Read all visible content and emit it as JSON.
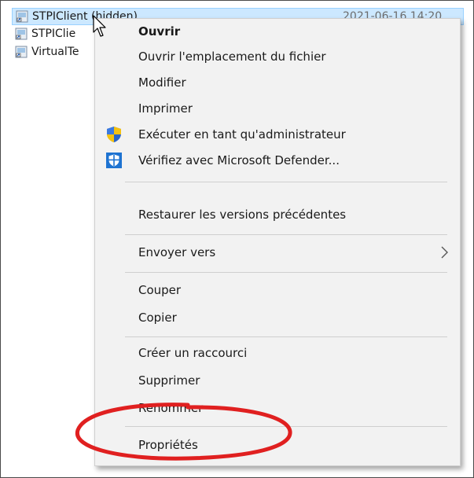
{
  "files": [
    {
      "name": "STPIClient (hidden)",
      "date": "2021-06-16 14:20",
      "icon": "shortcut-file-icon",
      "selected": true
    },
    {
      "name": "STPIClie",
      "icon": "shortcut-file-icon",
      "selected": false
    },
    {
      "name": "VirtualTe",
      "icon": "shortcut-file-icon",
      "selected": false
    }
  ],
  "context_menu": {
    "items": [
      {
        "label": "Ouvrir",
        "bold": true
      },
      {
        "label": "Ouvrir l'emplacement du fichier"
      },
      {
        "label": "Modifier"
      },
      {
        "label": "Imprimer"
      },
      {
        "label": "Exécuter en tant qu'administrateur",
        "icon": "uac-shield-icon"
      },
      {
        "label": "Vérifiez avec Microsoft Defender...",
        "icon": "defender-icon"
      },
      {
        "label": "Restaurer les versions précédentes"
      },
      {
        "label": "Envoyer vers",
        "submenu": true
      },
      {
        "label": "Couper"
      },
      {
        "label": "Copier"
      },
      {
        "label": "Créer un raccourci"
      },
      {
        "label": "Supprimer"
      },
      {
        "label": "Renommer"
      },
      {
        "label": "Propriétés"
      }
    ]
  },
  "annotation": {
    "type": "red-ellipse-highlight",
    "target": "Propriétés",
    "color": "#e02020"
  },
  "colors": {
    "selection_bg": "#cce8ff",
    "menu_bg": "#f2f2f2",
    "separator": "#cfcfcf"
  }
}
